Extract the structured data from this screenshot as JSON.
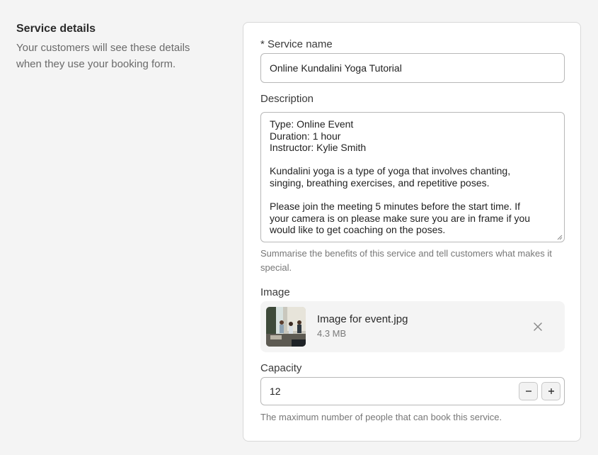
{
  "intro": {
    "title": "Service details",
    "description": "Your customers will see these details when they use your booking form."
  },
  "form": {
    "service_name": {
      "label": "* Service name",
      "value": "Online Kundalini Yoga Tutorial"
    },
    "description": {
      "label": "Description",
      "value": "Type: Online Event\nDuration: 1 hour\nInstructor: Kylie Smith\n\nKundalini yoga is a type of yoga that involves chanting,\nsinging, breathing exercises, and repetitive poses.\n\nPlease join the meeting 5 minutes before the start time. If\nyour camera is on please make sure you are in frame if you\nwould like to get coaching on the poses.",
      "hint": "Summarise the benefits of this service and tell customers what makes it special."
    },
    "image": {
      "label": "Image",
      "file_name": "Image for event.jpg",
      "file_size": "4.3 MB",
      "thumbnail_icon": "yoga-photo-thumbnail",
      "remove_icon": "close-icon"
    },
    "capacity": {
      "label": "Capacity",
      "value": "12",
      "hint": "The maximum number of people that can book this service.",
      "decrement_icon": "minus-icon",
      "increment_icon": "plus-icon"
    }
  },
  "colors": {
    "page_background": "#f4f4f4",
    "card_background": "#ffffff",
    "border": "#b8b8b8",
    "muted_text": "#777777"
  }
}
